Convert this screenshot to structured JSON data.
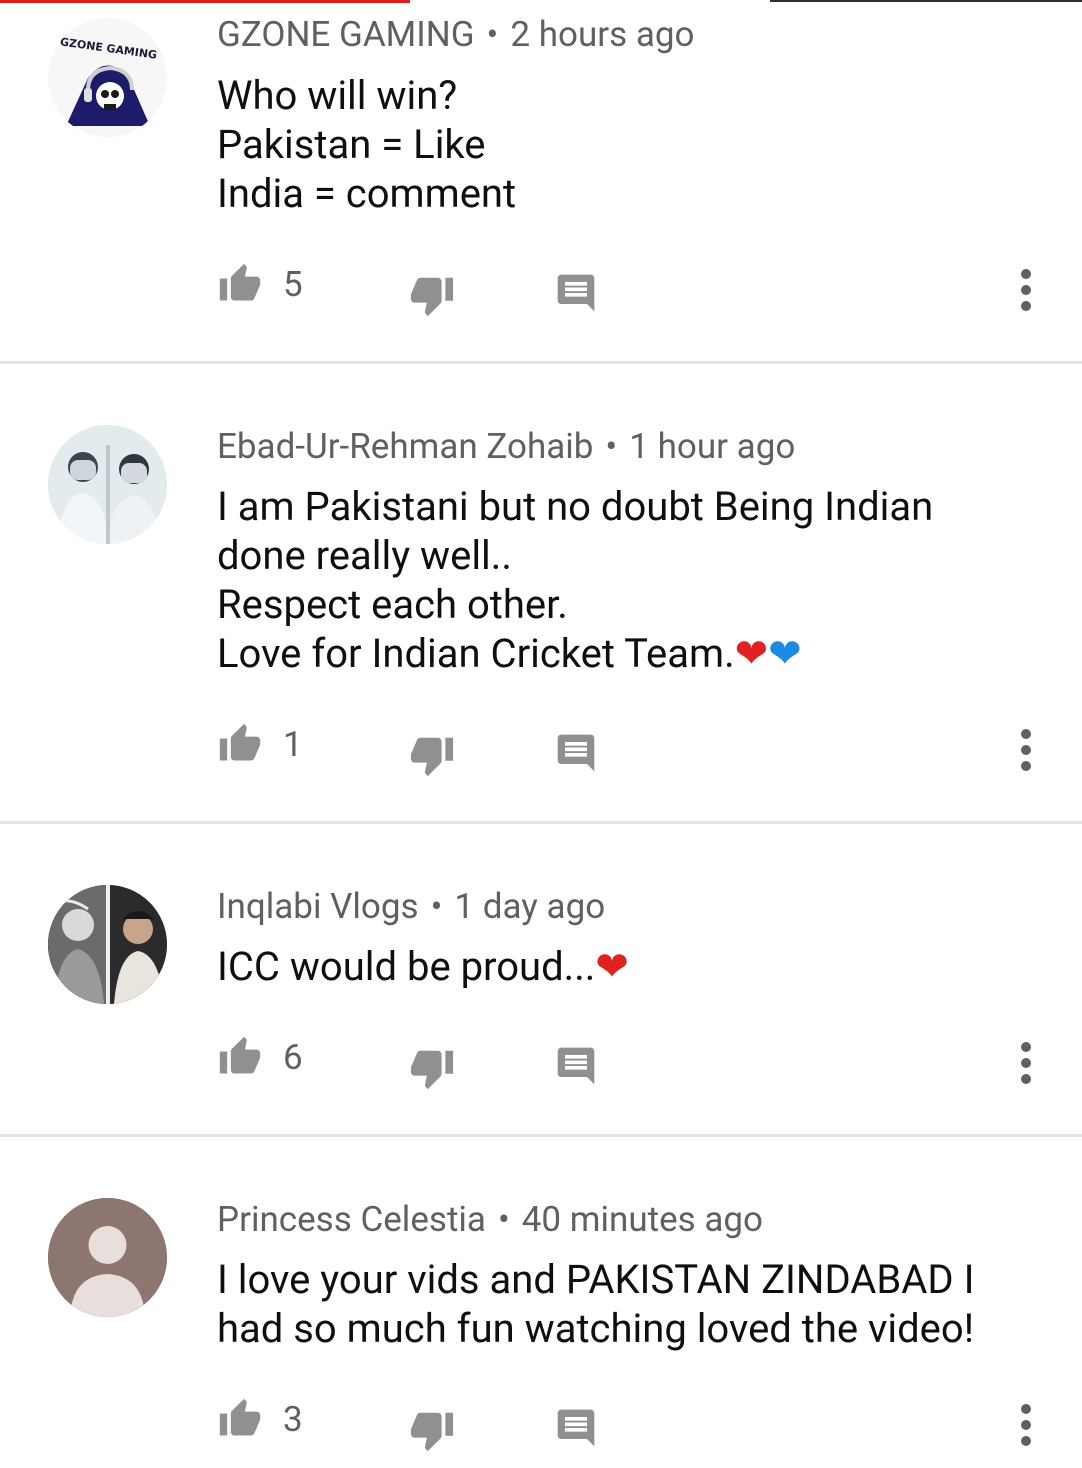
{
  "comments": [
    {
      "author": "GZONE GAMING",
      "time": "2 hours ago",
      "lines": [
        "Who will win?",
        "Pakistan = Like",
        "India = comment"
      ],
      "likes": "5",
      "avatar_text": "GZONE GAMING"
    },
    {
      "author": "Ebad-Ur-Rehman Zohaib",
      "time": "1 hour ago",
      "lines": [
        "I am Pakistani but no doubt Being Indian",
        "done really well..",
        "Respect each other.",
        "Love for Indian Cricket Team."
      ],
      "likes": "1"
    },
    {
      "author": "Inqlabi Vlogs",
      "time": "1 day ago",
      "lines": [
        "ICC would be proud..."
      ],
      "likes": "6"
    },
    {
      "author": "Princess Celestia",
      "time": "40 minutes ago",
      "lines": [
        "I love your vids and PAKISTAN ZINDABAD I",
        "had so much fun watching loved the video!"
      ],
      "likes": "3"
    }
  ],
  "emoji": {
    "red_heart": "❤",
    "blue_heart": "❤"
  },
  "separator": "•",
  "colors": {
    "meta_text": "#606060",
    "body_text": "#0f0f0f",
    "icon": "#909090",
    "divider": "#e3e3e3",
    "progress": "#e21b1b"
  }
}
